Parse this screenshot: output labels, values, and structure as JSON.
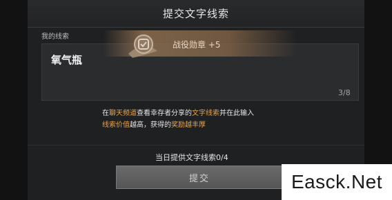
{
  "dialog": {
    "title": "提交文字线索",
    "clue_label": "我的线索",
    "input_value": "氧气瓶",
    "counter": "3/8"
  },
  "reward": {
    "icon": "medal-icon",
    "text": "战役勋章 +5"
  },
  "hint": {
    "part1": "在",
    "part2": "聊天频道",
    "part3": "查看幸存者分享的",
    "part4": "文字线索",
    "part5": "并在此输入",
    "part6": "线索价值",
    "part7": "越高，获得的",
    "part8": "奖励越丰厚"
  },
  "daily": {
    "text": "当日提供文字线索0/4"
  },
  "actions": {
    "submit_label": "提交"
  },
  "watermark": {
    "text": "Easck.Net"
  },
  "colors": {
    "highlight": "#e8a44a",
    "background": "#1f2022",
    "button": "#5f5f5f"
  }
}
